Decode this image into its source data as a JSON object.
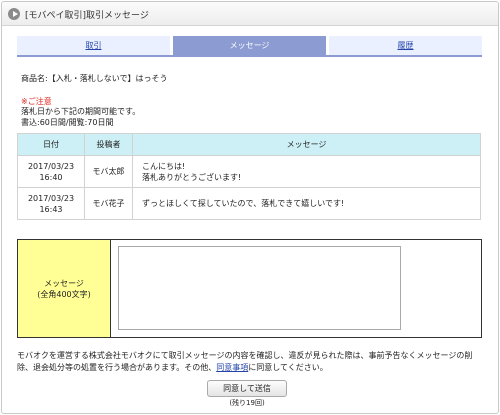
{
  "window": {
    "title": "[モバペイ取引]取引メッセージ"
  },
  "tabs": [
    {
      "label": "取引",
      "state": "link"
    },
    {
      "label": "メッセージ",
      "state": "active"
    },
    {
      "label": "履歴",
      "state": "link"
    }
  ],
  "product": {
    "label": "商品名:【入札・落札しないで】はっそう"
  },
  "caution": {
    "heading": "※ご注意",
    "line1": "落札日から下記の期間可能です。",
    "line2": "書込:60日間/閲覧:70日間"
  },
  "messages_table": {
    "headers": [
      "日付",
      "投稿者",
      "メッセージ"
    ],
    "rows": [
      {
        "date": "2017/03/23",
        "time": "16:40",
        "user": "モバ太郎",
        "msg1": "こんにちは!",
        "msg2": "落札ありがとうございます!"
      },
      {
        "date": "2017/03/23",
        "time": "16:43",
        "user": "モバ花子",
        "msg1": "ずっとほしくて探していたので、落札できて嬉しいです!",
        "msg2": ""
      }
    ]
  },
  "form": {
    "label_line1": "メッセージ",
    "label_line2": "(全角400文字)",
    "textarea_value": ""
  },
  "notice": {
    "text_before": "モバオクを運営する株式会社モバオクにて取引メッセージの内容を確認し、違反が見られた際は、事前予告なくメッセージの削除、退会処分等の処置を行う場合があります。その他、",
    "link": "同意事項",
    "text_after": "に同意してください。"
  },
  "submit": {
    "label": "同意して送信",
    "remaining": "(残り19回)"
  },
  "colors": {
    "tab_active": "#8c9bd2",
    "tab_inactive": "#eaf0ff",
    "table_header": "#cdf0f7",
    "label_cell": "#ffff96",
    "caution": "#e0201a"
  }
}
